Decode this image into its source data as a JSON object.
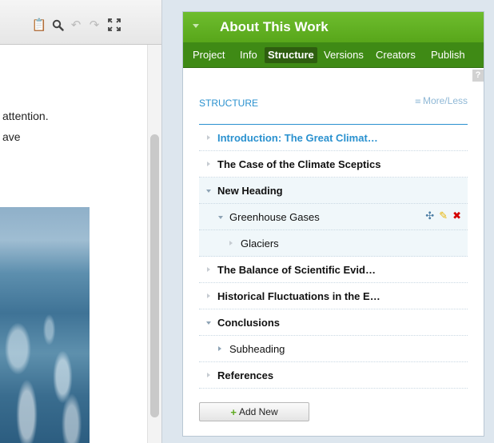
{
  "editor": {
    "toolbar": {
      "icons": [
        "clipboard-icon",
        "search-icon",
        "undo-icon",
        "redo-icon",
        "fullscreen-icon"
      ],
      "glyphs": {
        "clipboard": "📋",
        "search": "⚲",
        "undo": "↶",
        "redo": "↷",
        "fullscreen": "⤢"
      }
    },
    "text_line_1": "attention.",
    "text_line_2": "ave"
  },
  "panel": {
    "title": "About This Work",
    "tabs": [
      {
        "label": "Project"
      },
      {
        "label": "Info"
      },
      {
        "label": "Structure",
        "active": true
      },
      {
        "label": "Versions"
      },
      {
        "label": "Creators"
      },
      {
        "label": "Publish"
      }
    ],
    "help": "?",
    "section_label": "STRUCTURE",
    "more_less": "More/Less",
    "more_less_icon": "≡",
    "tree": [
      {
        "label": "Introduction: The Great Climat…",
        "level": 0,
        "state": "collapsed-empty",
        "highlight": true
      },
      {
        "label": "The Case of the Climate Sceptics",
        "level": 0,
        "state": "collapsed-empty"
      },
      {
        "label": "New Heading",
        "level": 0,
        "state": "expanded"
      },
      {
        "label": "Greenhouse Gases",
        "level": 1,
        "state": "expanded",
        "actions": true
      },
      {
        "label": "Glaciers",
        "level": 2,
        "state": "collapsed-empty"
      },
      {
        "label": "The Balance of Scientific Evid…",
        "level": 0,
        "state": "collapsed-empty"
      },
      {
        "label": "Historical Fluctuations in the E…",
        "level": 0,
        "state": "collapsed-empty"
      },
      {
        "label": "Conclusions",
        "level": 0,
        "state": "expanded"
      },
      {
        "label": "Subheading",
        "level": 1,
        "state": "collapsed"
      },
      {
        "label": "References",
        "level": 0,
        "state": "collapsed-empty"
      }
    ],
    "action_glyphs": {
      "move": "✣",
      "edit": "✎",
      "delete": "✖"
    },
    "add_button": {
      "plus": "+",
      "label": "Add New"
    }
  },
  "colors": {
    "header_green": "#62b324",
    "tab_green": "#3f8a15",
    "link_blue": "#2a91cf",
    "delete_red": "#d40000",
    "edit_yellow": "#e8b400"
  }
}
